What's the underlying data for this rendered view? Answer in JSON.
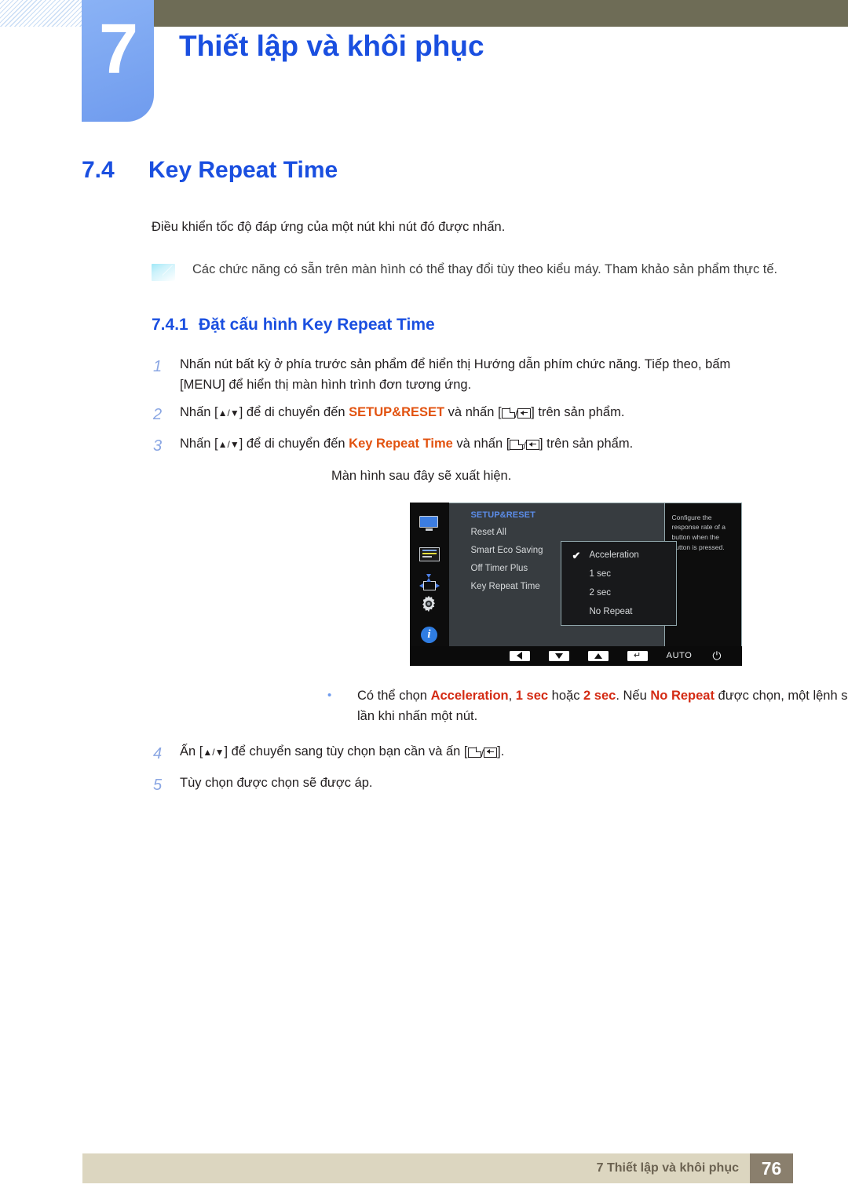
{
  "header": {
    "chapter_number": "7",
    "chapter_title": "Thiết lập và khôi phục"
  },
  "section": {
    "number": "7.4",
    "title": "Key Repeat Time",
    "intro": "Điều khiển tốc độ đáp ứng của một nút khi nút đó được nhấn.",
    "note": "Các chức năng có sẵn trên màn hình có thể thay đổi tùy theo kiểu máy. Tham khảo sản phẩm thực tế.",
    "note_icon": "note-card-icon"
  },
  "subsection": {
    "number": "7.4.1",
    "title": "Đặt cấu hình Key Repeat Time"
  },
  "steps": {
    "step1": {
      "num": "1",
      "text_a": "Nhấn nút bất kỳ ở phía trước sản phẩm để hiển thị Hướng dẫn phím chức năng. Tiếp theo, bấm",
      "text_b": "[MENU] để hiển thị màn hình trình đơn tương ứng."
    },
    "step2": {
      "num": "2",
      "pre": "Nhấn [",
      "mid": "] để di chuyển đến ",
      "keyword": "SETUP&RESET",
      "post": " và nhấn [",
      "tail": "] trên sản phẩm."
    },
    "step3": {
      "num": "3",
      "pre": "Nhấn [",
      "mid": "] để di chuyển đến ",
      "keyword": "Key Repeat Time",
      "post": " và nhấn [",
      "tail": "] trên sản phẩm.",
      "followup": "Màn hình sau đây sẽ xuất hiện."
    },
    "step4": {
      "num": "4",
      "pre": "Ấn [",
      "mid": "] để chuyển sang tùy chọn bạn cần và ấn [",
      "tail": "]."
    },
    "step5": {
      "num": "5",
      "text": "Tùy chọn được chọn sẽ được áp."
    }
  },
  "bullet": {
    "dot": "•",
    "t1": "Có thể chọn ",
    "k1": "Acceleration",
    "t2": ", ",
    "k2": "1 sec",
    "t3": " hoặc ",
    "k3": "2 sec",
    "t4": ". Nếu ",
    "k4": "No Repeat",
    "t5": " được chọn, một lệnh sẽ chỉ đáp ứng một lần khi nhấn một nút."
  },
  "osd": {
    "sidebar_icons": [
      "monitor-icon",
      "picture-settings-icon",
      "screen-position-icon",
      "gear-icon",
      "info-icon"
    ],
    "menu_title": "SETUP&RESET",
    "menu_items": [
      "Reset All",
      "Smart Eco Saving",
      "Off Timer Plus",
      "Key Repeat Time"
    ],
    "submenu_items": [
      {
        "label": "Acceleration",
        "checked": true,
        "check_glyph": "✔"
      },
      {
        "label": "1 sec",
        "checked": false,
        "check_glyph": ""
      },
      {
        "label": "2 sec",
        "checked": false,
        "check_glyph": ""
      },
      {
        "label": "No Repeat",
        "checked": false,
        "check_glyph": ""
      }
    ],
    "help_text": "Configure the response rate of a button when the button is pressed.",
    "bottom_bar": {
      "buttons": [
        "left-arrow-button",
        "down-arrow-button",
        "up-arrow-button",
        "enter-button"
      ],
      "enter_glyph": "↵",
      "auto_label": "AUTO",
      "power_glyph": "⏻"
    }
  },
  "footer": {
    "text": "7 Thiết lập và khôi phục",
    "page": "76"
  },
  "colors": {
    "heading_blue": "#1a4fe0",
    "olive": "#6e6c56",
    "badge_blue": "#7ea8f2",
    "keyword_orange": "#e2520f",
    "keyword_red": "#d42b14",
    "footer_band": "#dcd6c0",
    "footer_page_box": "#8a7f6d"
  }
}
